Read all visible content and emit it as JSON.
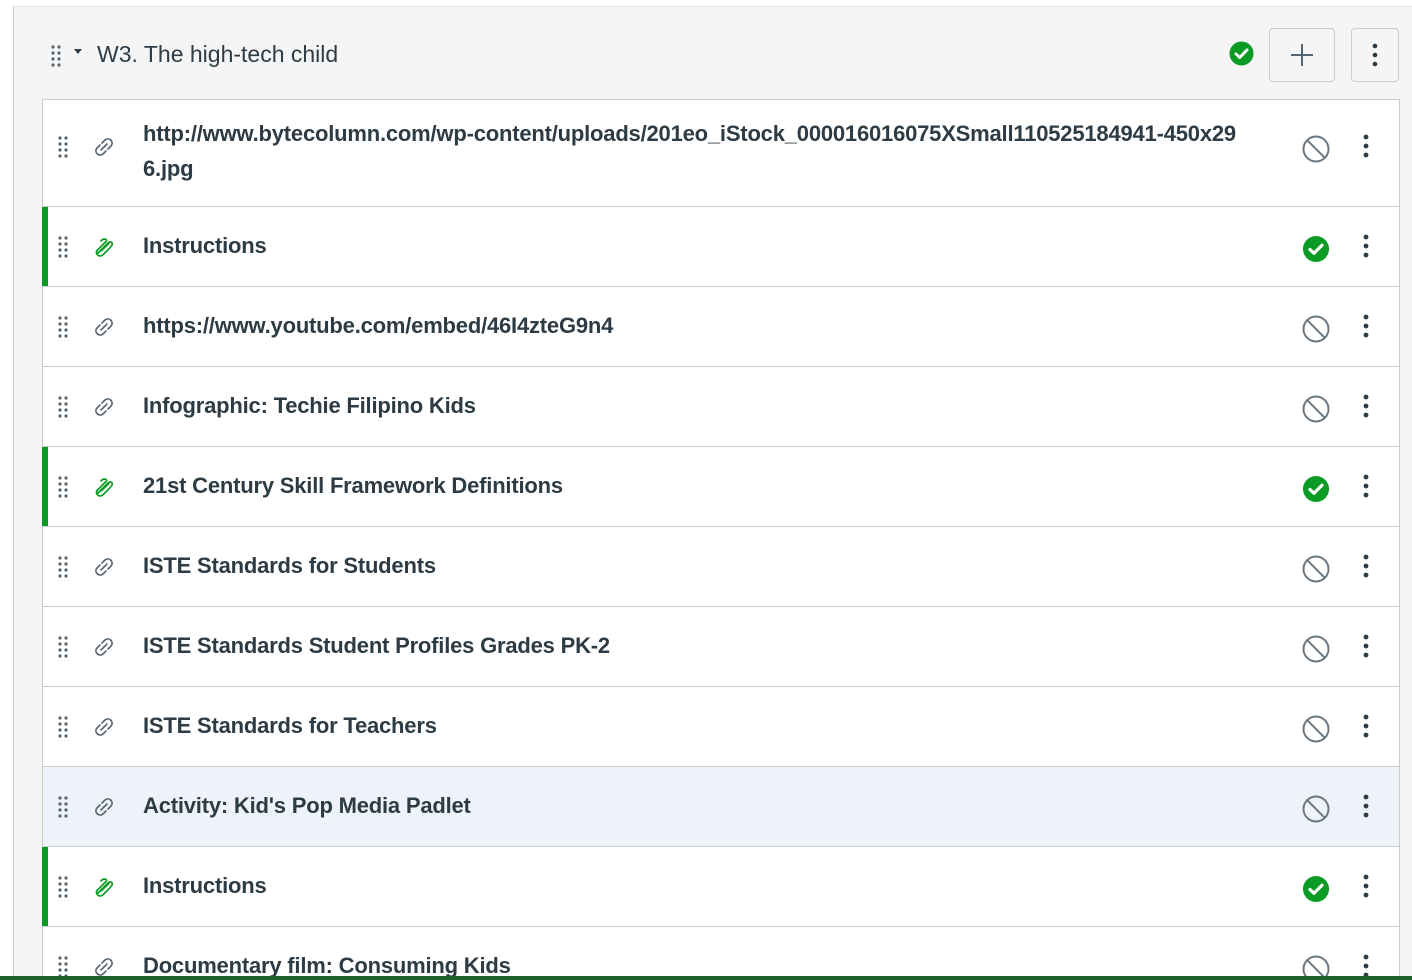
{
  "module": {
    "title": "W3. The high-tech child",
    "published": true,
    "add_button_icon": "plus-icon",
    "more_button_icon": "kebab-icon"
  },
  "colors": {
    "published_green": "#0b9a24",
    "hover_row": "#eef3f9",
    "border": "#c7cdd1",
    "text": "#2d3b45"
  },
  "items": [
    {
      "title": "http://www.bytecolumn.com/wp-content/uploads/201eo_iStock_000016016075XSmall110525184941-450x296.jpg",
      "type": "link",
      "status": "unpublished"
    },
    {
      "title": "Instructions",
      "type": "attachment",
      "status": "published"
    },
    {
      "title": "https://www.youtube.com/embed/46I4zteG9n4",
      "type": "link",
      "status": "unpublished"
    },
    {
      "title": "Infographic: Techie Filipino Kids",
      "type": "link",
      "status": "unpublished"
    },
    {
      "title": "21st Century Skill Framework Definitions",
      "type": "attachment",
      "status": "published"
    },
    {
      "title": "ISTE Standards for Students",
      "type": "link",
      "status": "unpublished"
    },
    {
      "title": "ISTE Standards Student Profiles Grades PK-2",
      "type": "link",
      "status": "unpublished"
    },
    {
      "title": "ISTE Standards for Teachers",
      "type": "link",
      "status": "unpublished"
    },
    {
      "title": "Activity: Kid's Pop Media Padlet",
      "type": "link",
      "status": "unpublished"
    },
    {
      "title": "Instructions",
      "type": "attachment",
      "status": "published"
    },
    {
      "title": "Documentary film: Consuming Kids",
      "type": "link",
      "status": "unpublished"
    }
  ]
}
